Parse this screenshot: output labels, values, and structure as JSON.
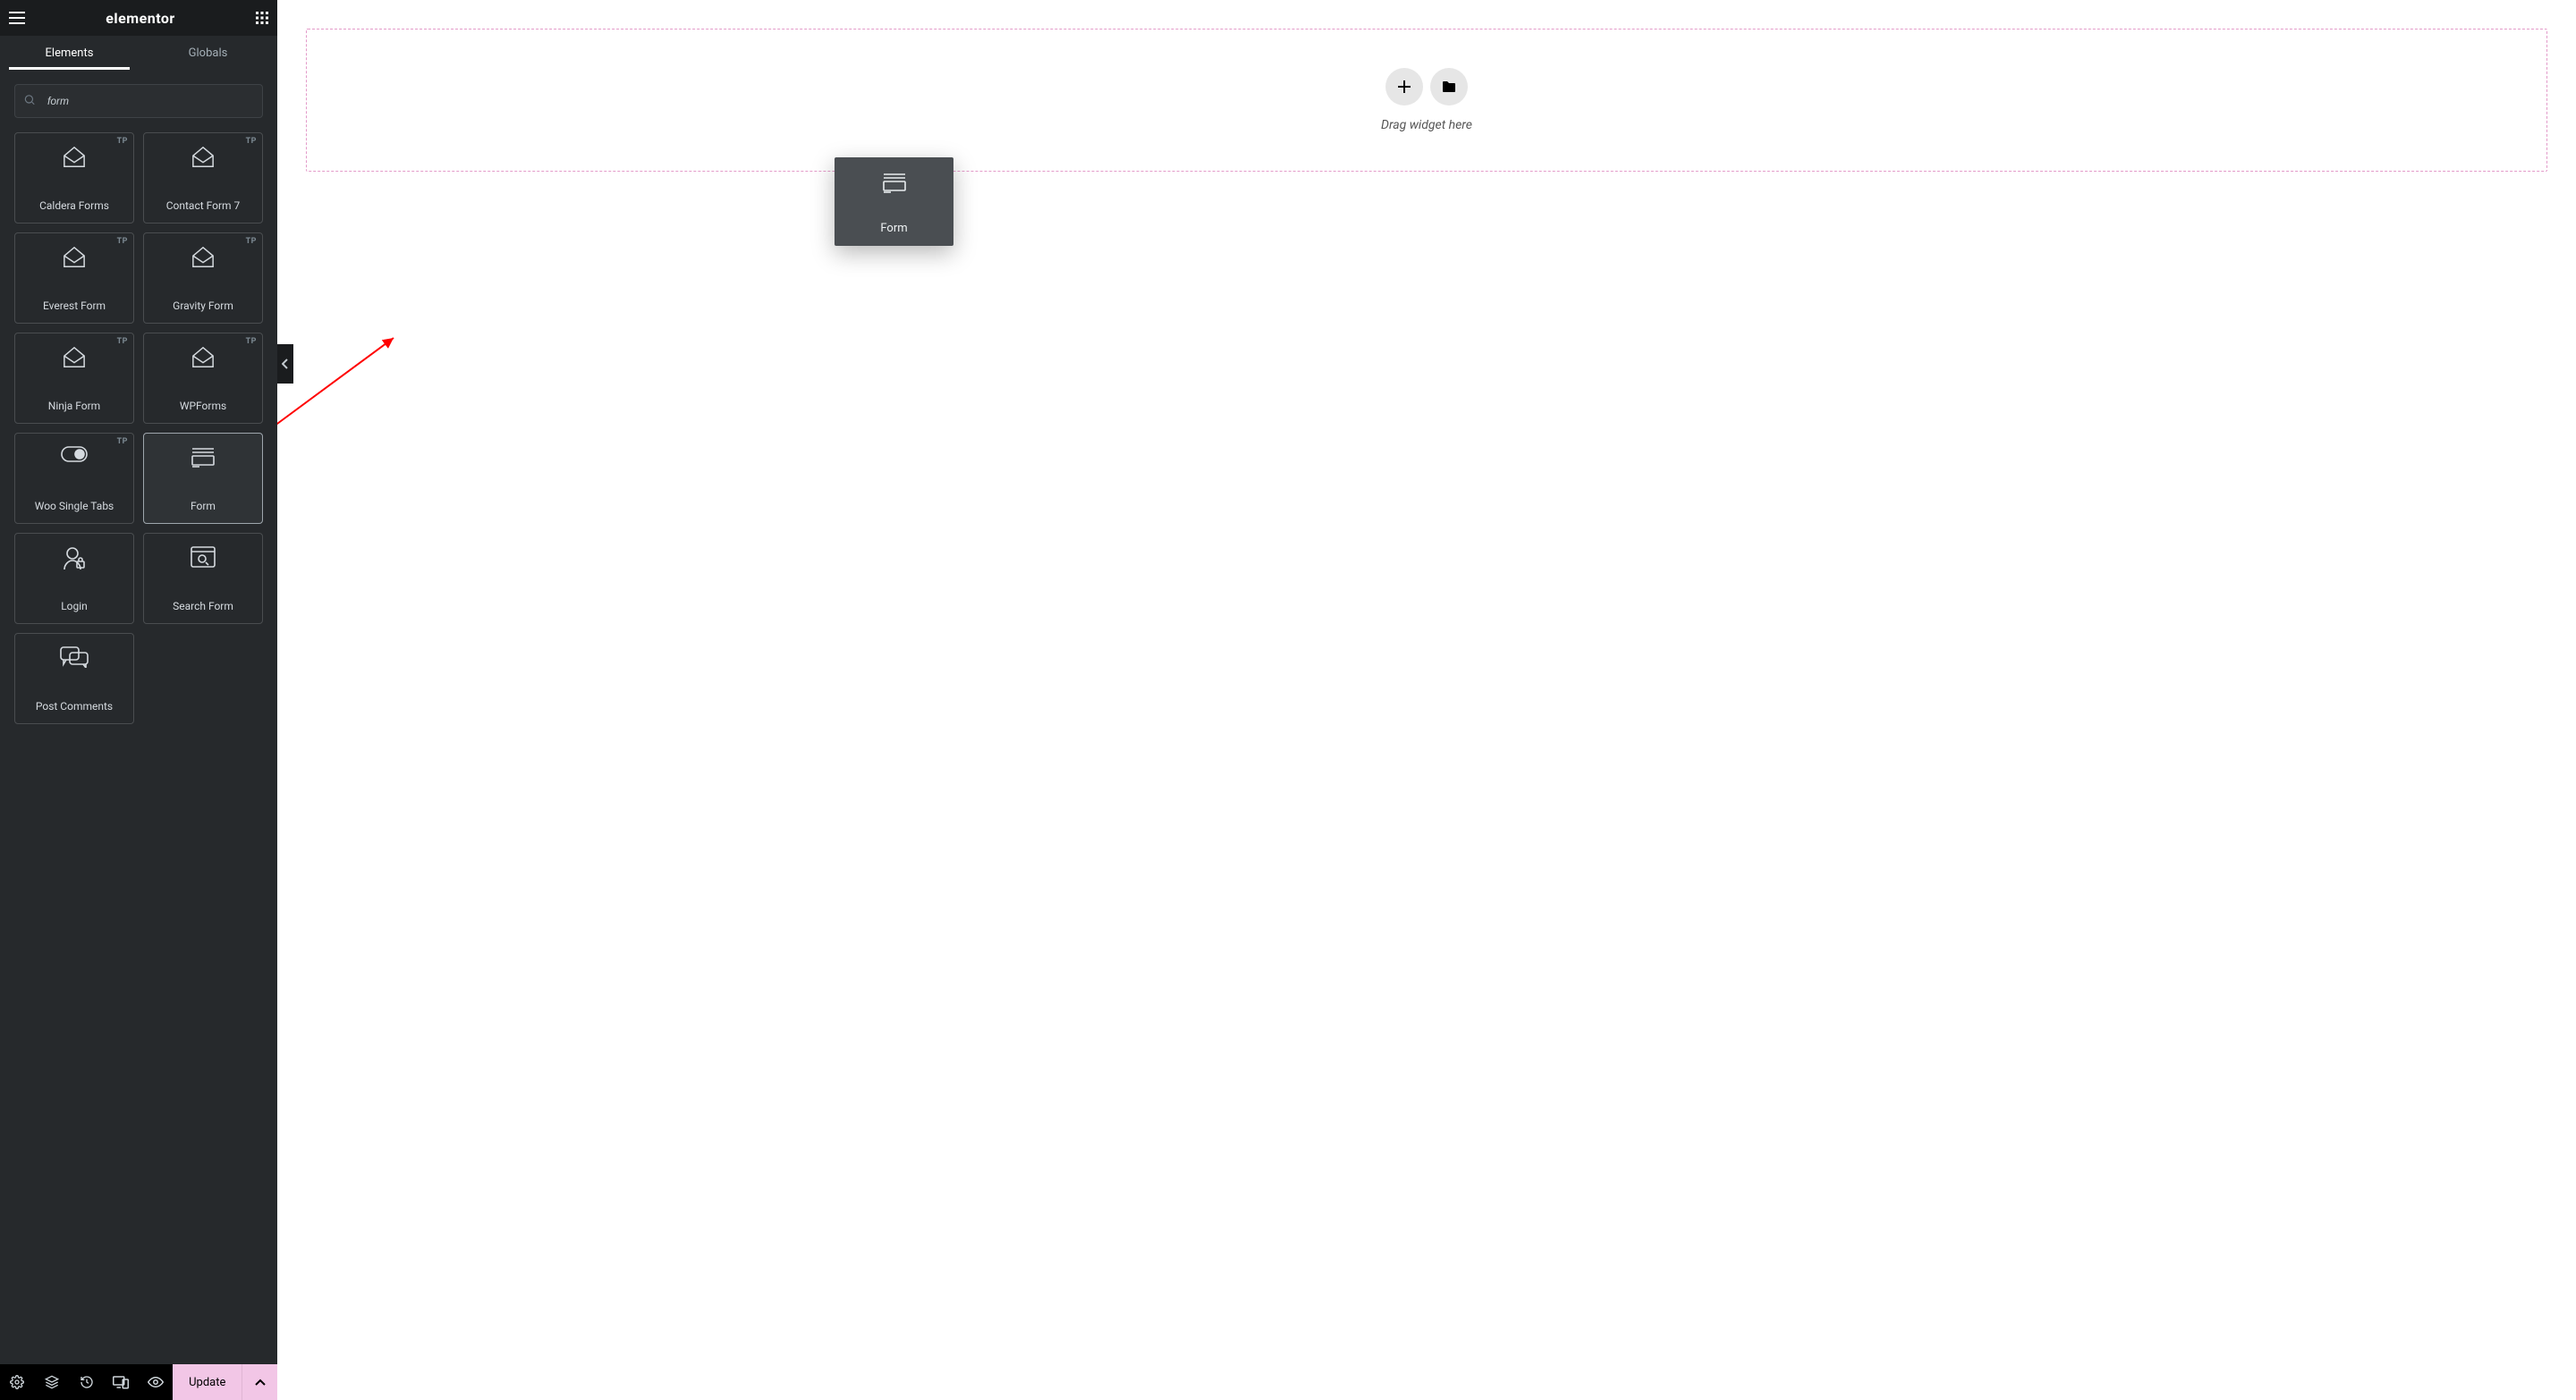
{
  "header": {
    "brand": "elementor"
  },
  "tabs": {
    "elements": "Elements",
    "globals": "Globals"
  },
  "search": {
    "value": "form"
  },
  "badge_tp": "TP",
  "widgets": [
    {
      "id": "caldera-forms",
      "label": "Caldera Forms",
      "icon": "envelope",
      "tp": true
    },
    {
      "id": "contact-form-7",
      "label": "Contact Form 7",
      "icon": "envelope",
      "tp": true
    },
    {
      "id": "everest-form",
      "label": "Everest Form",
      "icon": "envelope",
      "tp": true
    },
    {
      "id": "gravity-form",
      "label": "Gravity Form",
      "icon": "envelope",
      "tp": true
    },
    {
      "id": "ninja-form",
      "label": "Ninja Form",
      "icon": "envelope",
      "tp": true
    },
    {
      "id": "wpforms",
      "label": "WPForms",
      "icon": "envelope",
      "tp": true
    },
    {
      "id": "woo-single-tabs",
      "label": "Woo Single Tabs",
      "icon": "toggle",
      "tp": true
    },
    {
      "id": "form",
      "label": "Form",
      "icon": "form",
      "tp": false,
      "selected": true
    },
    {
      "id": "login",
      "label": "Login",
      "icon": "login",
      "tp": false
    },
    {
      "id": "search-form",
      "label": "Search Form",
      "icon": "searchwin",
      "tp": false
    },
    {
      "id": "post-comments",
      "label": "Post Comments",
      "icon": "comments",
      "tp": false
    }
  ],
  "dropzone": {
    "hint": "Drag widget here"
  },
  "drag_ghost": {
    "label": "Form"
  },
  "footer": {
    "update": "Update"
  }
}
